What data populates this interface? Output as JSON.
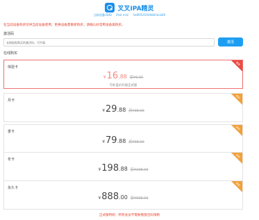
{
  "header": {
    "app_icon": "search-magnifier-icon",
    "title": "叉叉IPA精灵"
  },
  "device": {
    "udid_label": "当前设备UDID",
    "model": "iPad mini",
    "udid": "5e8f05450468b5dcb89"
  },
  "warning": "在当前设备购买仅供当前设备使用，更换设备需重新购买，请确认好常用设备再购买。",
  "activation": {
    "label": "激活码",
    "placeholder": "长按粘贴购买的激活码，可不填",
    "button": "激活"
  },
  "online_purchase_label": "在线购买",
  "plans": [
    {
      "name": "体验卡",
      "yen": "¥",
      "price_int": "16",
      "price_dec": ".88",
      "original": "原¥6.00",
      "note": "可补差价升级正式版",
      "badge": "推荐",
      "selected": true
    },
    {
      "name": "月卡",
      "yen": "¥",
      "price_int": "29",
      "price_dec": ".88",
      "original": "原¥38.00",
      "note": "",
      "badge": "折扣",
      "selected": false
    },
    {
      "name": "季卡",
      "yen": "¥",
      "price_int": "79",
      "price_dec": ".88",
      "original": "原¥98.00",
      "note": "",
      "badge": "折扣",
      "selected": false
    },
    {
      "name": "年卡",
      "yen": "¥",
      "price_int": "198",
      "price_dec": ".88",
      "original": "原¥298.00",
      "note": "",
      "badge": "折扣",
      "selected": false
    },
    {
      "name": "永久卡",
      "yen": "¥",
      "price_int": "888",
      "price_dec": ".00",
      "original": "原¥998.00",
      "note": "",
      "badge": "折扣",
      "selected": false
    }
  ],
  "footer": "正式版特权：所有会员不需要看激活码限制",
  "colors": {
    "accent": "#1e9ef2",
    "warning": "#e8432d",
    "badge_selected": "#e84b43",
    "badge": "#f2a038"
  }
}
